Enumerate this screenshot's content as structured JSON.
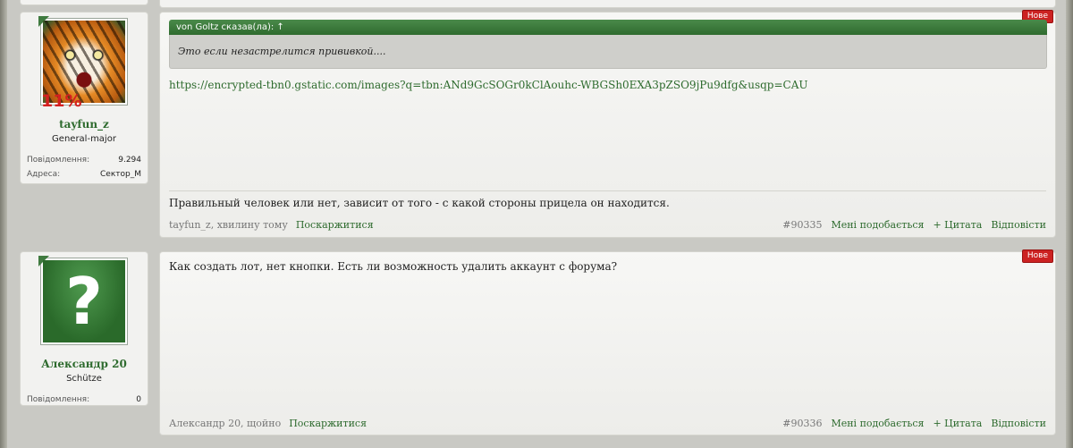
{
  "posts": [
    {
      "user": {
        "name": "tayfun_z",
        "rank": "General-major",
        "avatar_icon": "tiger-avatar-icon",
        "avatar_overlay": "11%",
        "stats": [
          {
            "label": "Повідомлення:",
            "value": "9.294"
          },
          {
            "label": "Адреса:",
            "value": "Сектор_М"
          }
        ]
      },
      "badge": "Нове",
      "quote": {
        "header": "von Goltz сказав(ла): ↑",
        "text": "Это если незастрелится прививкой...."
      },
      "link": "https://encrypted-tbn0.gstatic.com/images?q=tbn:ANd9GcSOGr0kClAouhc-WBGSh0EXA3pZSO9jPu9dfg&usqp=CAU",
      "signature": "Правильный человек или нет, зависит от того - с какой стороны прицела он находится.",
      "footer": {
        "author_time": "tayfun_z, хвилину тому",
        "report": "Поскаржитися",
        "post_number": "#90335",
        "like": "Мені подобається",
        "quote": "+ Цитата",
        "reply": "Відповісти"
      }
    },
    {
      "user": {
        "name": "Александр 20",
        "rank": "Schütze",
        "avatar_icon": "question-mark-avatar-icon",
        "avatar_glyph": "?",
        "stats": [
          {
            "label": "Повідомлення:",
            "value": "0"
          }
        ]
      },
      "badge": "Нове",
      "text": "Как создать лот, нет кнопки. Есть ли возможность удалить аккаунт с форума?",
      "footer": {
        "author_time": "Александр 20, щойно",
        "report": "Поскаржитися",
        "post_number": "#90336",
        "like": "Мені подобається",
        "quote": "+ Цитата",
        "reply": "Відповісти"
      }
    }
  ],
  "colors": {
    "accent_green": "#2e6b2e",
    "new_badge": "#cc2222",
    "background": "#c9c9c4"
  }
}
